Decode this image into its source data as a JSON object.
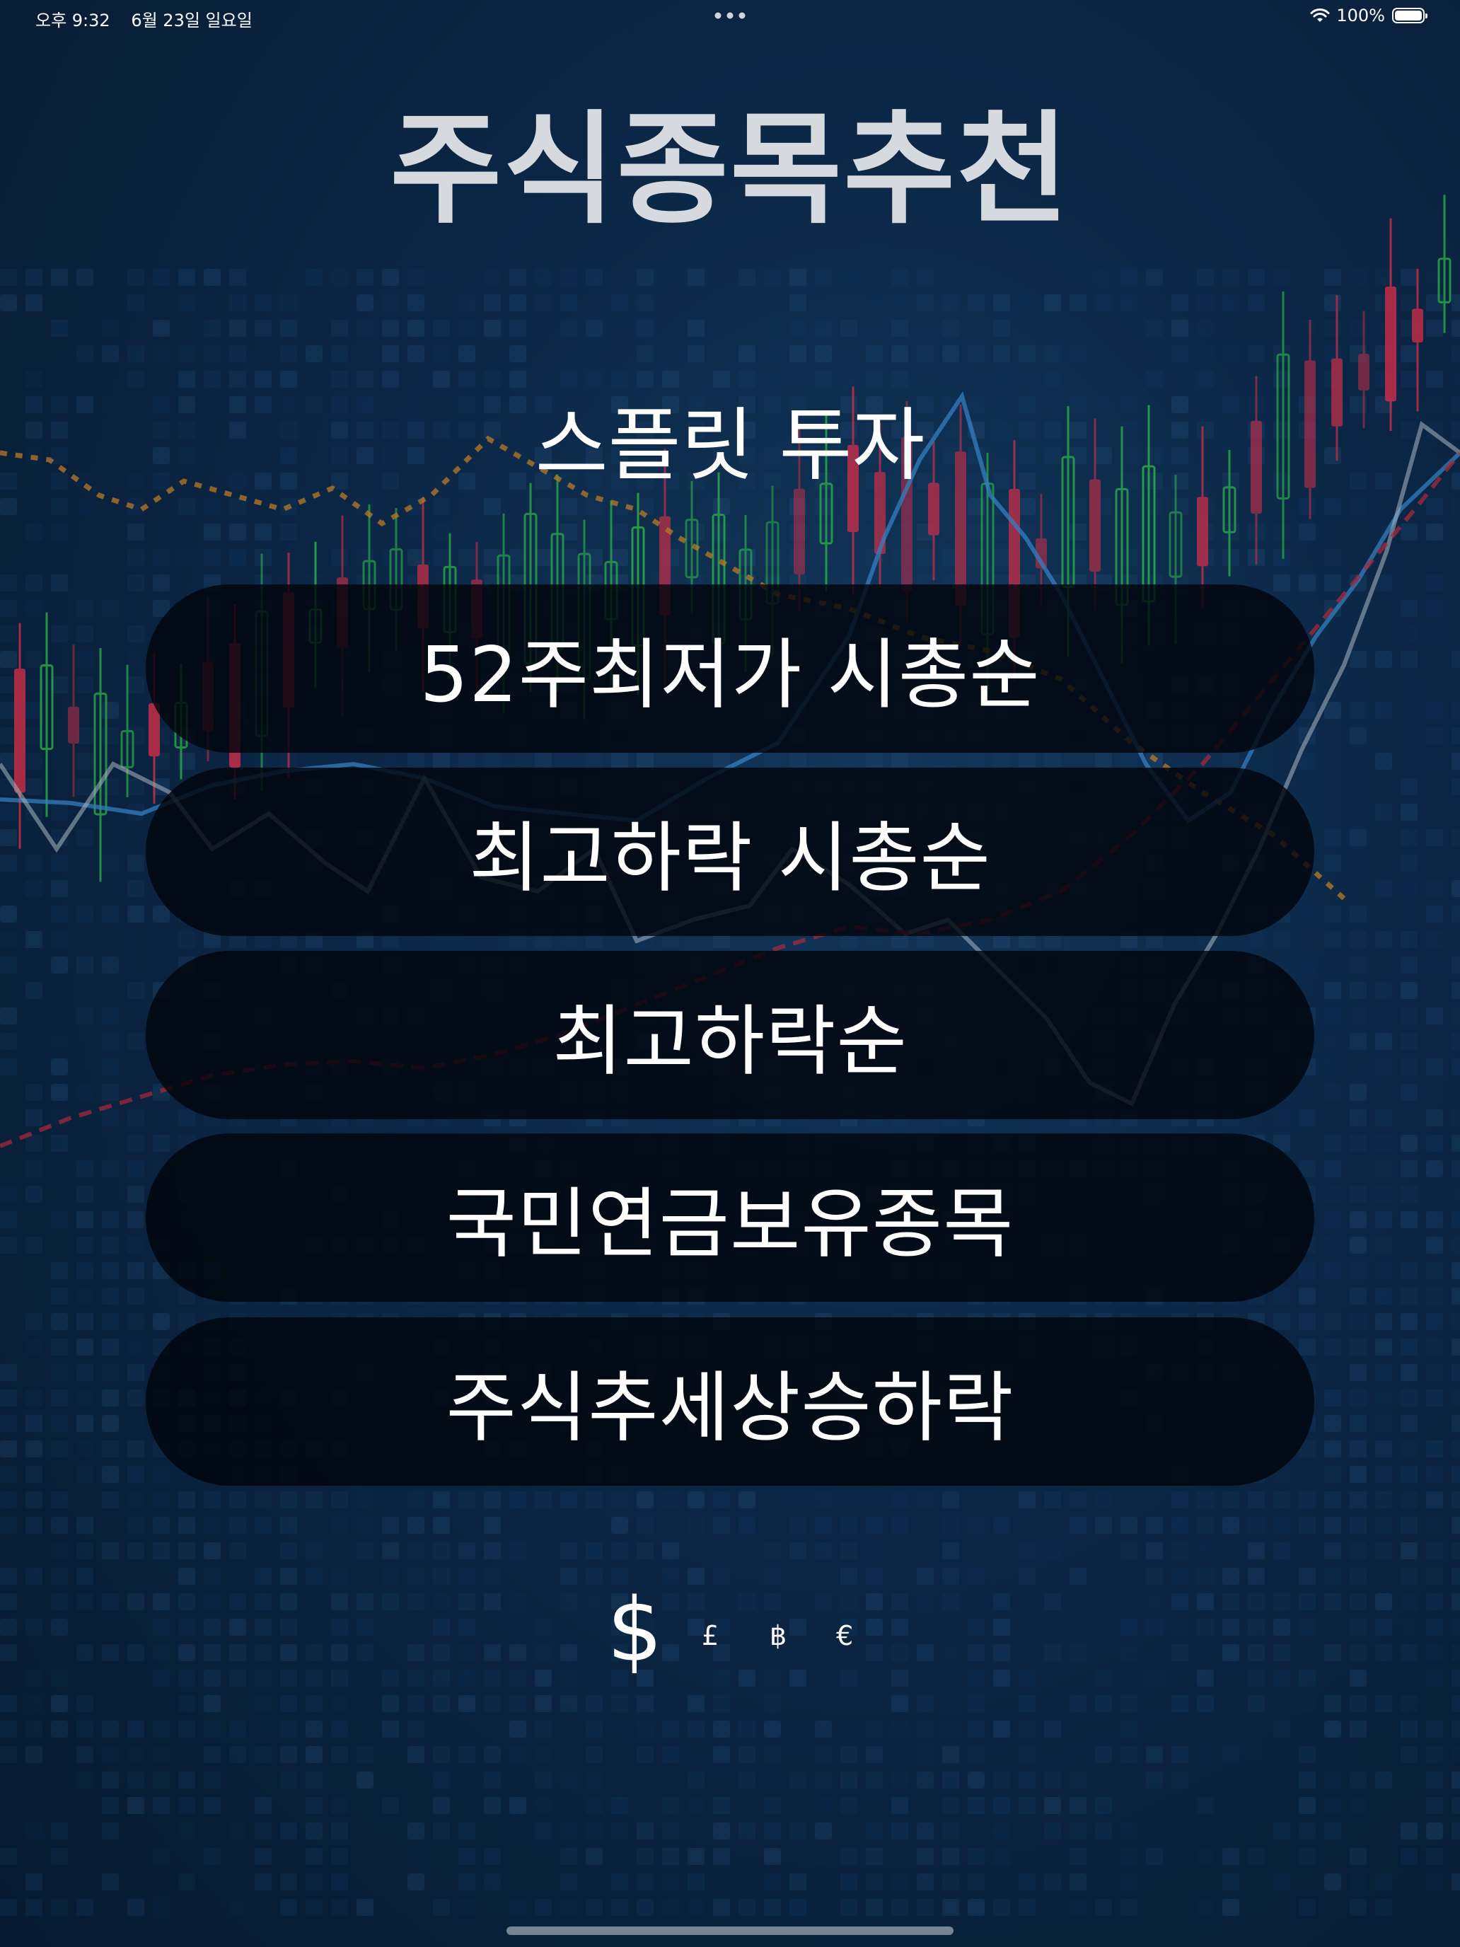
{
  "status_bar": {
    "time": "오후 9:32",
    "date": "6월 23일 일요일",
    "battery": "100%"
  },
  "title": "주식종목추천",
  "subtitle": "스플릿 투자",
  "menu": {
    "items": [
      {
        "label": "52주최저가 시총순"
      },
      {
        "label": "최고하락 시총순"
      },
      {
        "label": "최고하락순"
      },
      {
        "label": "국민연금보유종목"
      },
      {
        "label": "주식추세상승하락"
      }
    ]
  },
  "currency_symbols": [
    "$",
    "£",
    "฿",
    "€"
  ],
  "colors": {
    "background": "#0b2645",
    "title_text": "#d6d9dd",
    "button_fill": "#00040a",
    "candle_up": "#2fbf4a",
    "candle_down": "#e0304a",
    "trend_orange": "#d98a1f",
    "trend_blue": "#3b8fd6",
    "trend_red": "#c2283a"
  }
}
